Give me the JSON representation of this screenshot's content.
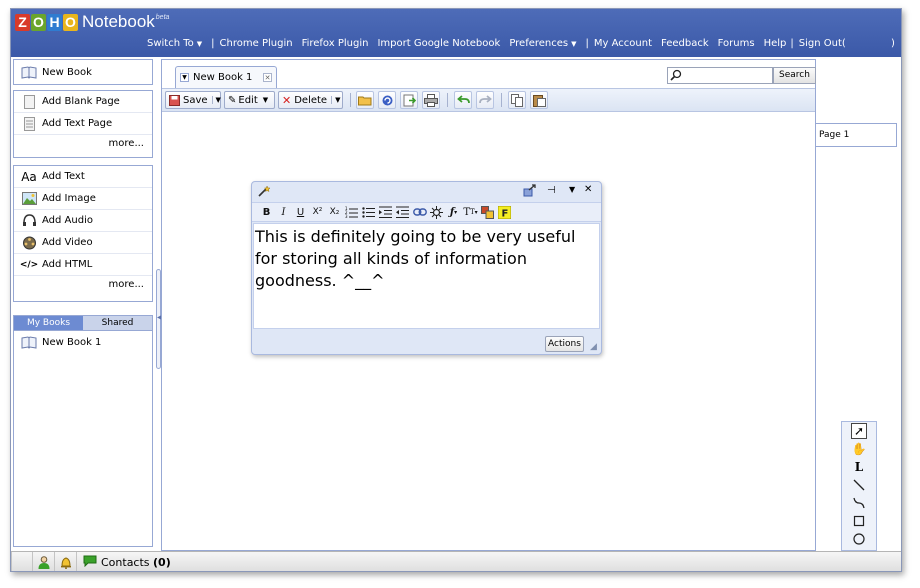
{
  "header": {
    "logo_letters": [
      "Z",
      "O",
      "H",
      "O"
    ],
    "logo_product": "Notebook",
    "logo_badge": "beta",
    "nav": [
      {
        "label": "Switch To",
        "dropdown": true
      },
      {
        "label": "Chrome Plugin"
      },
      {
        "label": "Firefox Plugin"
      },
      {
        "label": "Import Google Notebook"
      },
      {
        "label": "Preferences",
        "dropdown": true
      },
      {
        "label": "My Account"
      },
      {
        "label": "Feedback"
      },
      {
        "label": "Forums"
      },
      {
        "label": "Help"
      },
      {
        "label": "Sign Out("
      }
    ],
    "close_paren": ")"
  },
  "sidebar": {
    "new_book": "New Book",
    "pages": {
      "items": [
        "Add Blank Page",
        "Add Text Page"
      ],
      "more": "more..."
    },
    "content": {
      "items": [
        "Add Text",
        "Add Image",
        "Add Audio",
        "Add Video",
        "Add HTML"
      ],
      "more": "more..."
    },
    "book_tabs": {
      "active": "My Books",
      "other": "Shared"
    },
    "books": [
      "New Book 1"
    ]
  },
  "main": {
    "tab_label": "New Book 1",
    "search": {
      "placeholder": "",
      "button": "Search"
    },
    "toolbar": {
      "save": "Save",
      "edit": "Edit",
      "delete": "Delete",
      "icons": [
        "open-folder-icon",
        "refresh-icon",
        "export-icon",
        "print-icon",
        "undo-icon",
        "redo-icon",
        "copy-icon",
        "paste-icon"
      ]
    },
    "pages": [
      "Page 1"
    ]
  },
  "widget": {
    "text": "This is definitely going to be very useful for storing all kinds of information goodness. ^__^",
    "actions_label": "Actions",
    "format_buttons": [
      "B",
      "I",
      "U",
      "X²",
      "X₂"
    ]
  },
  "bottombar": {
    "contacts_label": "Contacts",
    "contacts_count": "(0)"
  }
}
